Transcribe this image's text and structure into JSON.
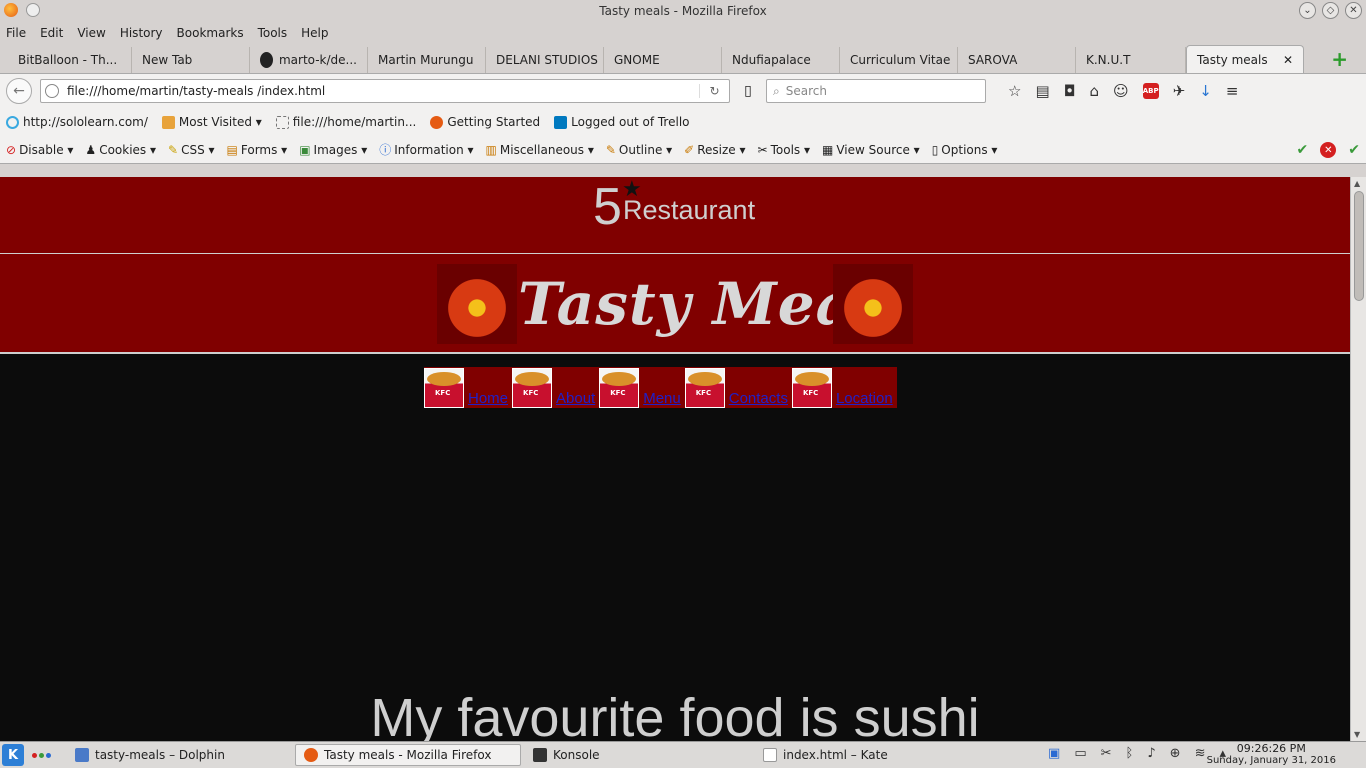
{
  "window": {
    "title": "Tasty meals - Mozilla Firefox"
  },
  "menu": [
    "File",
    "Edit",
    "View",
    "History",
    "Bookmarks",
    "Tools",
    "Help"
  ],
  "tabs": [
    {
      "label": "BitBalloon - Th..."
    },
    {
      "label": "New Tab"
    },
    {
      "label": "marto-k/de..."
    },
    {
      "label": "Martin Murungu"
    },
    {
      "label": "DELANI STUDIOS"
    },
    {
      "label": "GNOME"
    },
    {
      "label": "Ndufiapalace"
    },
    {
      "label": "Curriculum Vitae"
    },
    {
      "label": "SAROVA"
    },
    {
      "label": "K.N.U.T"
    },
    {
      "label": "Tasty meals",
      "close": "✕"
    }
  ],
  "navbar": {
    "url": "file:///home/martin/tasty-meals /index.html",
    "search_placeholder": "Search",
    "abp": "ABP"
  },
  "bookmarks": [
    {
      "label": "http://sololearn.com/"
    },
    {
      "label": "Most Visited ▾"
    },
    {
      "label": "file:///home/martin..."
    },
    {
      "label": "Getting Started"
    },
    {
      "label": "Logged out of Trello"
    }
  ],
  "devbar": [
    {
      "label": "Disable ▾",
      "icon": "⊘"
    },
    {
      "label": "Cookies ▾",
      "icon": "♟"
    },
    {
      "label": "CSS ▾",
      "icon": "✎"
    },
    {
      "label": "Forms ▾",
      "icon": "▤"
    },
    {
      "label": "Images ▾",
      "icon": "▣"
    },
    {
      "label": "Information ▾",
      "icon": "ⓘ"
    },
    {
      "label": "Miscellaneous ▾",
      "icon": "▥"
    },
    {
      "label": "Outline ▾",
      "icon": "✎"
    },
    {
      "label": "Resize ▾",
      "icon": "✐"
    },
    {
      "label": "Tools ▾",
      "icon": "✂"
    },
    {
      "label": "View Source ▾",
      "icon": "▦"
    },
    {
      "label": "Options ▾",
      "icon": "▯"
    }
  ],
  "page": {
    "rating_number": "5",
    "rating_star": "★",
    "rating_label": "Restaurant",
    "brand": "Tasty Meals",
    "nav": [
      "Home",
      "About",
      "Menu",
      "Contacts",
      "Location"
    ],
    "hero": "My favourite food is sushi"
  },
  "taskbar": {
    "tasks": [
      {
        "label": "tasty-meals  – Dolphin"
      },
      {
        "label": "Tasty meals - Mozilla Firefox"
      },
      {
        "label": "Konsole"
      },
      {
        "label": "index.html – Kate"
      }
    ],
    "time": "09:26:26 PM",
    "date": "Sunday, January 31, 2016"
  }
}
